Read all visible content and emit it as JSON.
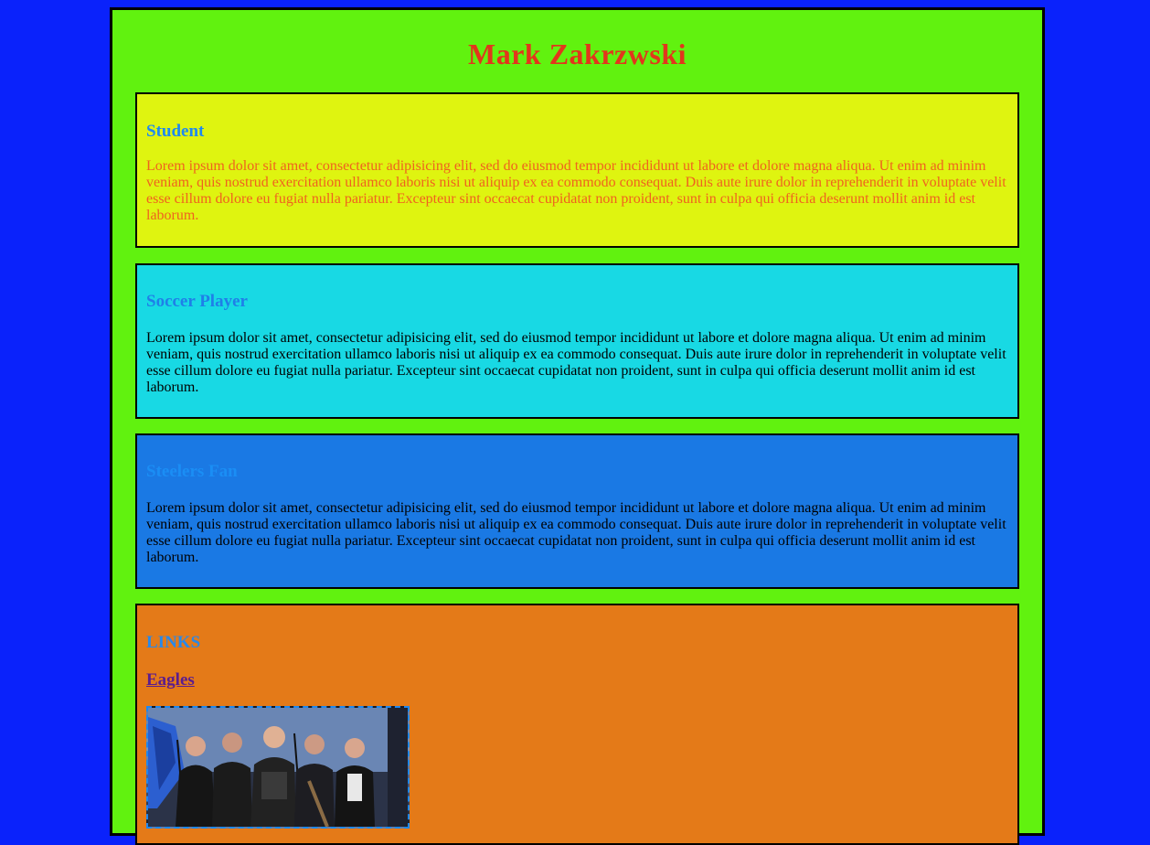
{
  "header": {
    "title": "Mark Zakrzwski"
  },
  "sections": [
    {
      "heading": "Student",
      "text": "Lorem ipsum dolor sit amet, consectetur adipisicing elit, sed do eiusmod tempor incididunt ut labore et dolore magna aliqua. Ut enim ad minim veniam, quis nostrud exercitation ullamco laboris nisi ut aliquip ex ea commodo consequat. Duis aute irure dolor in reprehenderit in voluptate velit esse cillum dolore eu fugiat nulla pariatur. Excepteur sint occaecat cupidatat non proident, sunt in culpa qui officia deserunt mollit anim id est laborum."
    },
    {
      "heading": "Soccer Player",
      "text": "Lorem ipsum dolor sit amet, consectetur adipisicing elit, sed do eiusmod tempor incididunt ut labore et dolore magna aliqua. Ut enim ad minim veniam, quis nostrud exercitation ullamco laboris nisi ut aliquip ex ea commodo consequat. Duis aute irure dolor in reprehenderit in voluptate velit esse cillum dolore eu fugiat nulla pariatur. Excepteur sint occaecat cupidatat non proident, sunt in culpa qui officia deserunt mollit anim id est laborum."
    },
    {
      "heading": "Steelers Fan",
      "text": "Lorem ipsum dolor sit amet, consectetur adipisicing elit, sed do eiusmod tempor incididunt ut labore et dolore magna aliqua. Ut enim ad minim veniam, quis nostrud exercitation ullamco laboris nisi ut aliquip ex ea commodo consequat. Duis aute irure dolor in reprehenderit in voluptate velit esse cillum dolore eu fugiat nulla pariatur. Excepteur sint occaecat cupidatat non proident, sunt in culpa qui officia deserunt mollit anim id est laborum."
    }
  ],
  "links": {
    "heading": "LINKS",
    "items": [
      {
        "label": "Eagles",
        "image": "band-photo"
      }
    ]
  },
  "colors": {
    "body_background": "#0a22fb",
    "page_background": "#61f20f",
    "title": "#e2361c",
    "student_background": "#dff410",
    "soccer_background": "#18d9e4",
    "steelers_background": "#1a79e4",
    "links_background": "#e47a18",
    "heading": "#1e88f0",
    "visited_link": "#5b1d8e"
  }
}
